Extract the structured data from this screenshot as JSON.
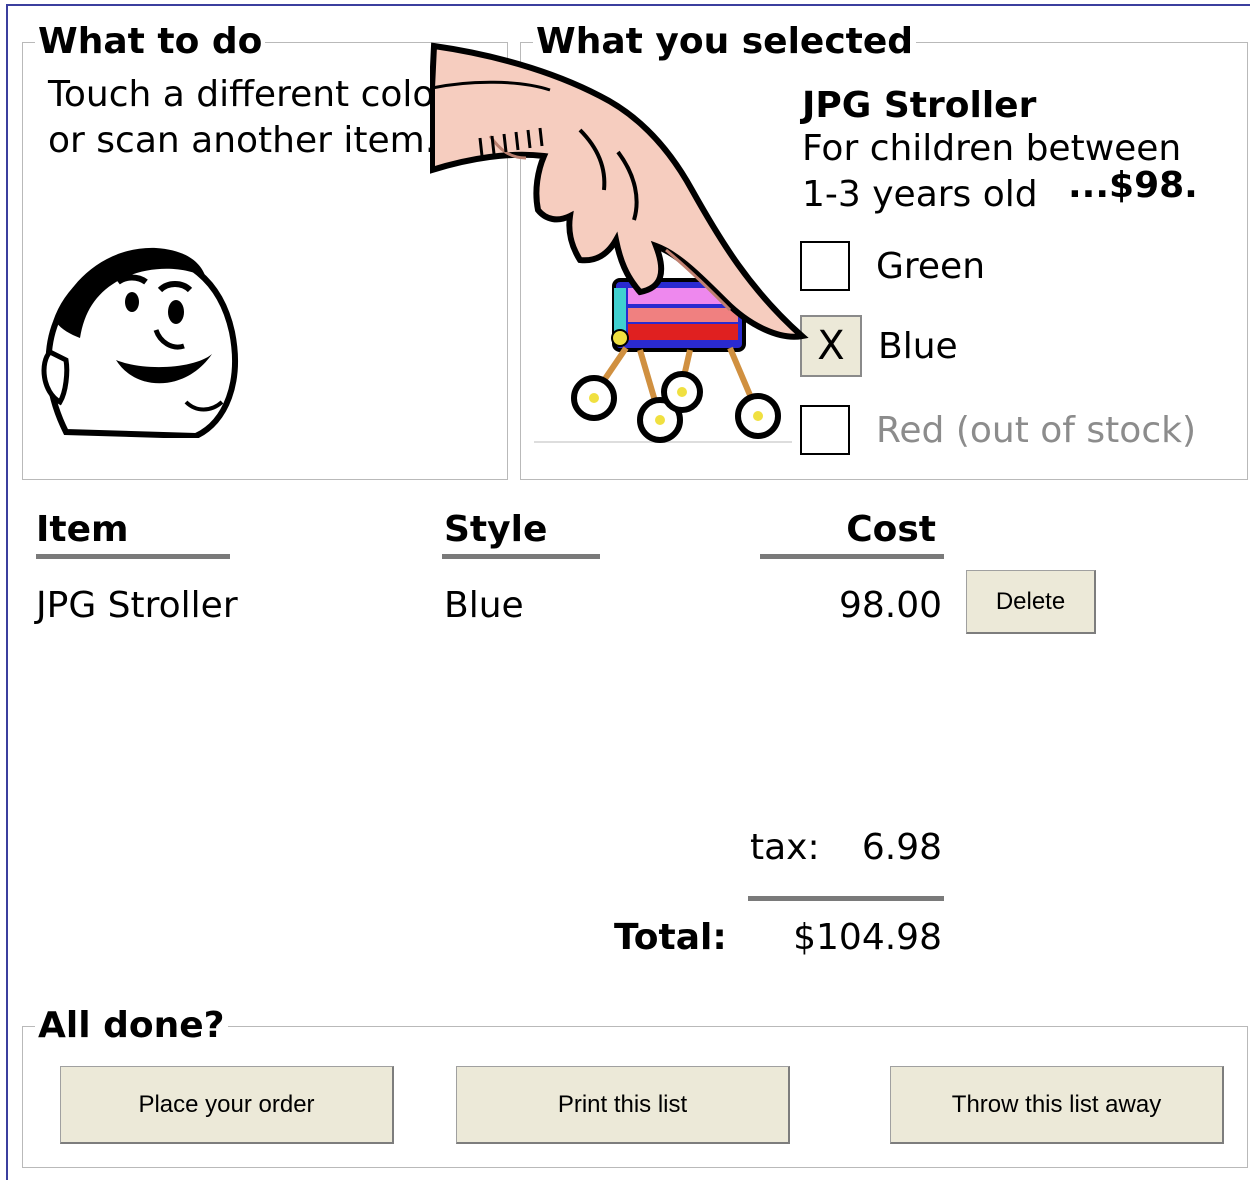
{
  "what_to_do": {
    "legend": "What to do",
    "instruction_line1": "Touch a different color",
    "instruction_line2": "or scan another item."
  },
  "selection": {
    "legend": "What you selected",
    "product_name": "JPG Stroller",
    "description_line1": "For children between",
    "description_line2": "1-3 years old",
    "price": "...$98.",
    "options": [
      {
        "label": "Green",
        "checked": false,
        "available": true
      },
      {
        "label": "Blue",
        "checked": true,
        "available": true,
        "mark": "X"
      },
      {
        "label": "Red (out of stock)",
        "checked": false,
        "available": false
      }
    ]
  },
  "list": {
    "headers": {
      "item": "Item",
      "style": "Style",
      "cost": "Cost"
    },
    "rows": [
      {
        "item": "JPG Stroller",
        "style": "Blue",
        "cost": "98.00",
        "delete_label": "Delete"
      }
    ]
  },
  "summary": {
    "tax_label": "tax:",
    "tax_value": "6.98",
    "total_label": "Total:",
    "total_value": "$104.98"
  },
  "all_done": {
    "legend": "All done?",
    "place_order_label": "Place your order",
    "print_label": "Print this list",
    "throw_away_label": "Throw this list away"
  },
  "colors": {
    "frame_border": "#3b3f9e",
    "button_face": "#ece9d8",
    "rule_gray": "#7a7a7a",
    "disabled_text": "#8c8c8c"
  }
}
